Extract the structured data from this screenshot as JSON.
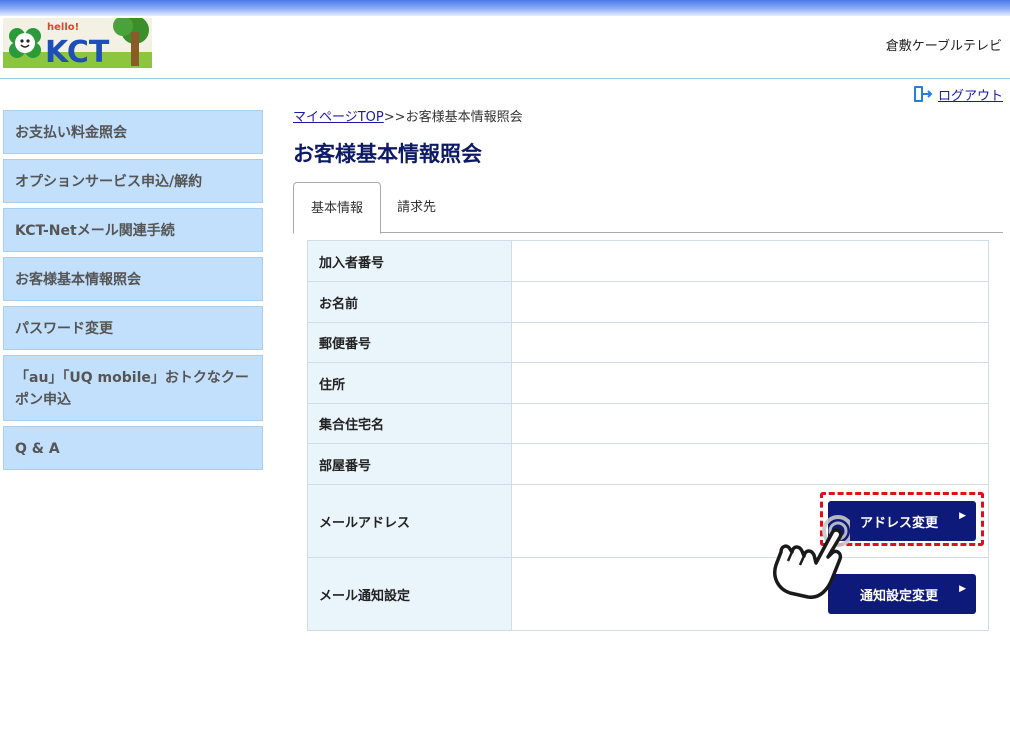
{
  "header": {
    "logo_alt": "hello! KCT",
    "company": "倉敷ケーブルテレビ"
  },
  "logout": {
    "label": "ログアウト"
  },
  "sidebar": {
    "items": [
      {
        "label": "お支払い料金照会"
      },
      {
        "label": "オプションサービス申込/解約"
      },
      {
        "label": "KCT-Netメール関連手続"
      },
      {
        "label": "お客様基本情報照会"
      },
      {
        "label": "パスワード変更"
      },
      {
        "label": "「au」「UQ mobile」おトクなクーポン申込"
      },
      {
        "label": "Q & A"
      }
    ]
  },
  "breadcrumb": {
    "link": "マイページTOP",
    "separator": ">>",
    "current": "お客様基本情報照会"
  },
  "page": {
    "title": "お客様基本情報照会"
  },
  "tabs": [
    {
      "label": "基本情報",
      "active": true
    },
    {
      "label": "請求先",
      "active": false
    }
  ],
  "info_table": {
    "rows": [
      {
        "label": "加入者番号",
        "value": ""
      },
      {
        "label": "お名前",
        "value": ""
      },
      {
        "label": "郵便番号",
        "value": ""
      },
      {
        "label": "住所",
        "value": ""
      },
      {
        "label": "集合住宅名",
        "value": ""
      },
      {
        "label": "部屋番号",
        "value": ""
      },
      {
        "label": "メールアドレス",
        "value": "",
        "button": "アドレス変更"
      },
      {
        "label": "メール通知設定",
        "value": "",
        "button": "通知設定変更"
      }
    ]
  },
  "colors": {
    "accent_navy": "#0e1a7a",
    "sidebar_bg": "#c2e0fb",
    "label_bg": "#e9f4fb",
    "highlight_red": "#e0101a"
  }
}
